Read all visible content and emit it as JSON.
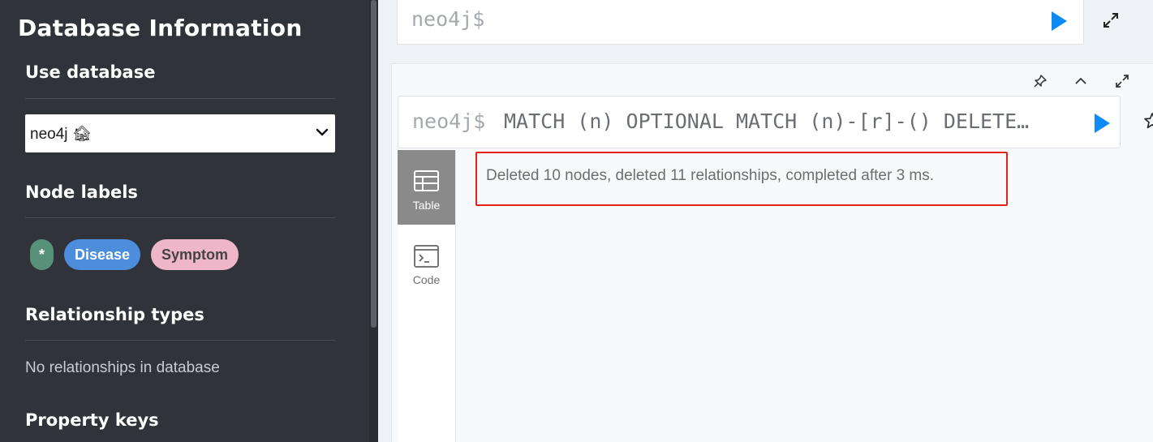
{
  "sidebar": {
    "title": "Database Information",
    "use_database": {
      "heading": "Use database",
      "selected": "neo4j 🏚"
    },
    "node_labels": {
      "heading": "Node labels",
      "items": [
        "*",
        "Disease",
        "Symptom"
      ]
    },
    "relationship_types": {
      "heading": "Relationship types",
      "empty_text": "No relationships in database"
    },
    "property_keys": {
      "heading": "Property keys"
    }
  },
  "editor": {
    "prompt": "neo4j$"
  },
  "frame": {
    "prompt": "neo4j$",
    "query": "MATCH (n) OPTIONAL MATCH (n)-[r]-() DELETE…",
    "tabs": [
      {
        "label": "Table",
        "icon": "table-icon"
      },
      {
        "label": "Code",
        "icon": "code-icon"
      }
    ],
    "active_tab": "Table",
    "result_message": "Deleted 10 nodes, deleted 11 relationships, completed after 3 ms."
  },
  "colors": {
    "sidebar_bg": "#30333a",
    "accent_play": "#0e8af5",
    "label_all": "#57917a",
    "label_disease": "#4c8edc",
    "label_symptom": "#eeb6c8",
    "highlight_border": "#e2231a"
  }
}
